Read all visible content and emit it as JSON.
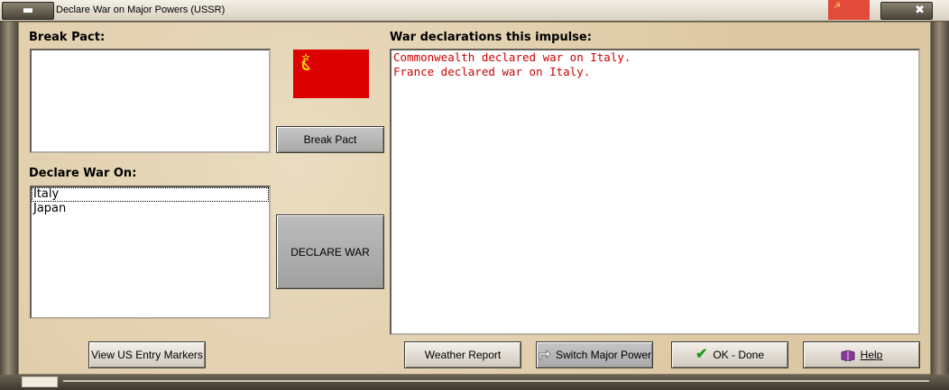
{
  "window": {
    "title": "Declare War on Major Powers (USSR)"
  },
  "break_pact": {
    "heading": "Break Pact:",
    "items": [],
    "button_label": "Break Pact"
  },
  "declare_war": {
    "heading": "Declare War On:",
    "items": [
      "Italy",
      "Japan"
    ],
    "selected": "Italy",
    "button_label": "DECLARE WAR"
  },
  "declarations": {
    "heading": "War declarations this impulse:",
    "lines": [
      "Commonwealth declared war on Italy.",
      "France declared war on Italy."
    ],
    "text_color": "#dd0000"
  },
  "flag": {
    "country": "USSR",
    "color": "#dd0000",
    "emblem": "hammer-and-sickle-icon"
  },
  "footer_buttons": {
    "us_entry": "View US Entry Markers",
    "weather": "Weather Report",
    "switch": "Switch Major Power",
    "ok": "OK - Done",
    "help": "Help"
  }
}
